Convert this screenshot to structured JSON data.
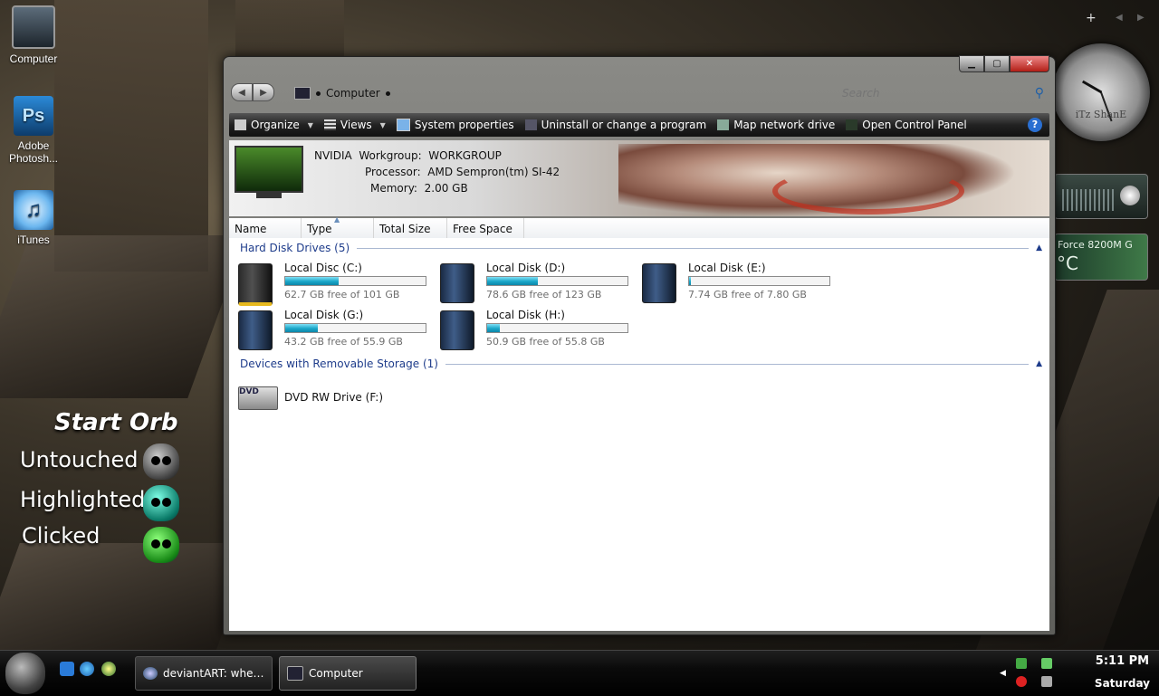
{
  "desktop": {
    "icons": [
      {
        "label": "Computer"
      },
      {
        "label": "Adobe Photosh..."
      },
      {
        "label": "iTunes"
      }
    ],
    "orb_legend": {
      "title": "Start Orb",
      "rows": [
        "Untouched",
        "Highlighted",
        "Clicked"
      ]
    },
    "gadgets": {
      "clock_text": "iTz ShanE",
      "gpu_name": "Force 8200M G",
      "gpu_unit": "°C"
    }
  },
  "window": {
    "address": {
      "crumb": "Computer"
    },
    "search": {
      "placeholder": "Search"
    },
    "toolbar": {
      "items": [
        {
          "label": "Organize",
          "has_dropdown": true
        },
        {
          "label": "Views",
          "has_dropdown": true
        },
        {
          "label": "System properties"
        },
        {
          "label": "Uninstall or change a program"
        },
        {
          "label": "Map network drive"
        },
        {
          "label": "Open Control Panel"
        }
      ],
      "help": "?"
    },
    "details": {
      "computer_name": "NVIDIA",
      "workgroup_label": "Workgroup:",
      "workgroup": "WORKGROUP",
      "processor_label": "Processor:",
      "processor": "AMD Sempron(tm) SI-42",
      "memory_label": "Memory:",
      "memory": "2.00 GB"
    },
    "columns": [
      "Name",
      "Type",
      "Total Size",
      "Free Space"
    ],
    "groups": [
      {
        "title": "Hard Disk Drives (5)",
        "drives": [
          {
            "name": "Local Disc (C:)",
            "free_text": "62.7 GB free of 101 GB",
            "used_fraction": 0.38,
            "system": true
          },
          {
            "name": "Local Disk (D:)",
            "free_text": "78.6 GB free of 123 GB",
            "used_fraction": 0.36,
            "system": false
          },
          {
            "name": "Local Disk (E:)",
            "free_text": "7.74 GB free of 7.80 GB",
            "used_fraction": 0.01,
            "system": false
          },
          {
            "name": "Local Disk (G:)",
            "free_text": "43.2 GB free of 55.9 GB",
            "used_fraction": 0.23,
            "system": false
          },
          {
            "name": "Local Disk (H:)",
            "free_text": "50.9 GB free of 55.8 GB",
            "used_fraction": 0.09,
            "system": false
          }
        ]
      },
      {
        "title": "Devices with Removable Storage (1)",
        "drives": [
          {
            "name": "DVD RW Drive (F:)"
          }
        ]
      }
    ]
  },
  "taskbar": {
    "tasks": [
      {
        "label": "deviantART: where ..."
      },
      {
        "label": "Computer"
      }
    ],
    "time": "5:11 PM",
    "day": "Saturday"
  },
  "colors": {
    "accent": "#1e3c8b",
    "bar_fill": "#1aa6c8",
    "window_close": "#b21e16"
  }
}
